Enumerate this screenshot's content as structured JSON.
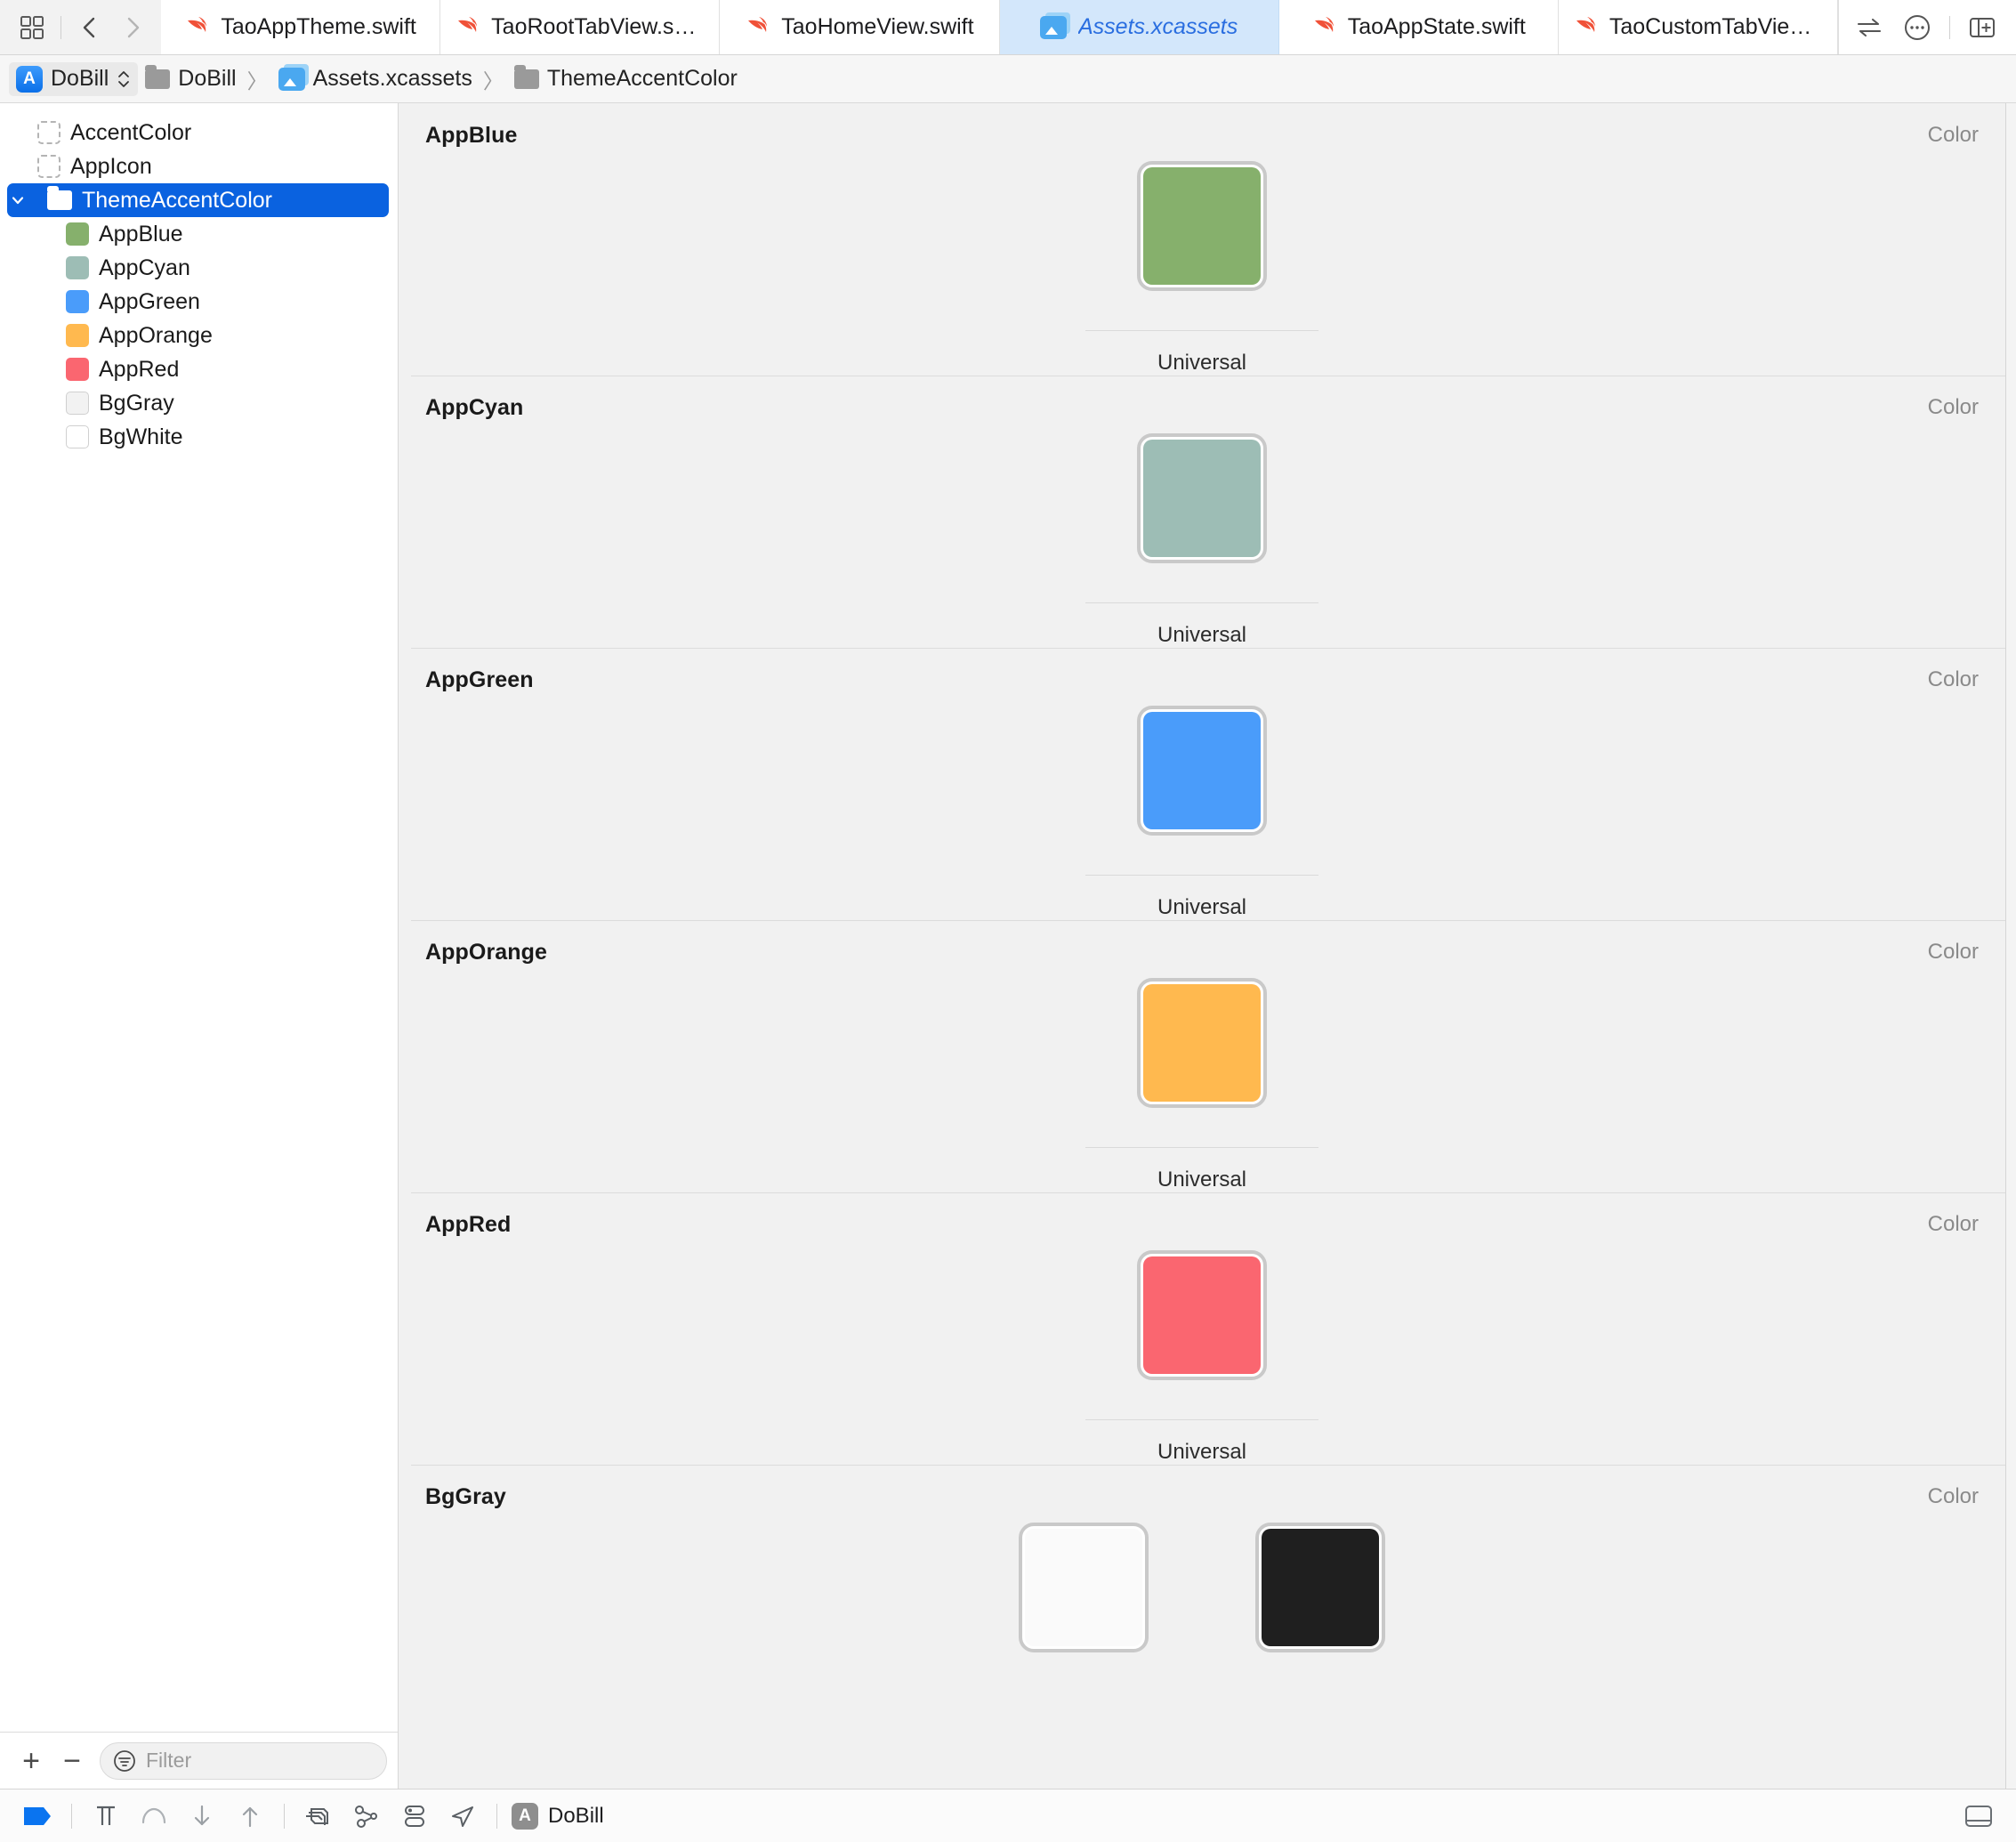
{
  "window": {
    "toolbar_right": [
      "swap-icon",
      "more-icon",
      "panel-right-icon"
    ]
  },
  "tabs": [
    {
      "label": "TaoAppTheme.swift",
      "icon": "swift-icon",
      "active": false
    },
    {
      "label": "TaoRootTabView.swift",
      "icon": "swift-icon",
      "active": false
    },
    {
      "label": "TaoHomeView.swift",
      "icon": "swift-icon",
      "active": false
    },
    {
      "label": "Assets.xcassets",
      "icon": "assets-icon",
      "active": true
    },
    {
      "label": "TaoAppState.swift",
      "icon": "swift-icon",
      "active": false
    },
    {
      "label": "TaoCustomTabView.swift",
      "icon": "swift-icon",
      "active": false
    }
  ],
  "breadcrumb": {
    "scheme": "DoBill",
    "items": [
      {
        "label": "DoBill",
        "icon": "folder-icon"
      },
      {
        "label": "Assets.xcassets",
        "icon": "assets-icon"
      },
      {
        "label": "ThemeAccentColor",
        "icon": "folder-icon"
      }
    ],
    "separator": "〉"
  },
  "sidebar": {
    "items": [
      {
        "label": "AccentColor",
        "icon": "placeholder-swatch-icon",
        "kind": "dashed",
        "color": "",
        "indent": 0,
        "selected": false
      },
      {
        "label": "AppIcon",
        "icon": "placeholder-swatch-icon",
        "kind": "dashed",
        "color": "",
        "indent": 0,
        "selected": false
      },
      {
        "label": "ThemeAccentColor",
        "icon": "folder-icon",
        "kind": "folder",
        "color": "",
        "indent": 0,
        "selected": true
      },
      {
        "label": "AppBlue",
        "icon": "color-swatch-icon",
        "kind": "color",
        "color": "#86b06c",
        "indent": 1,
        "selected": false
      },
      {
        "label": "AppCyan",
        "icon": "color-swatch-icon",
        "kind": "color",
        "color": "#9dbdb5",
        "indent": 1,
        "selected": false
      },
      {
        "label": "AppGreen",
        "icon": "color-swatch-icon",
        "kind": "color",
        "color": "#4a9cfa",
        "indent": 1,
        "selected": false
      },
      {
        "label": "AppOrange",
        "icon": "color-swatch-icon",
        "kind": "color",
        "color": "#ffb94f",
        "indent": 1,
        "selected": false
      },
      {
        "label": "AppRed",
        "icon": "color-swatch-icon",
        "kind": "color",
        "color": "#fa6670",
        "indent": 1,
        "selected": false
      },
      {
        "label": "BgGray",
        "icon": "color-swatch-icon",
        "kind": "outline",
        "color": "#f2f2f2",
        "indent": 1,
        "selected": false
      },
      {
        "label": "BgWhite",
        "icon": "color-swatch-icon",
        "kind": "outline",
        "color": "#ffffff",
        "indent": 1,
        "selected": false
      }
    ],
    "add_label": "+",
    "remove_label": "−",
    "filter_placeholder": "Filter"
  },
  "assets": {
    "kind_label": "Color",
    "sections": [
      {
        "name": "AppBlue",
        "variants": [
          {
            "label": "Universal",
            "color": "#86b06c"
          }
        ]
      },
      {
        "name": "AppCyan",
        "variants": [
          {
            "label": "Universal",
            "color": "#9dbdb5"
          }
        ]
      },
      {
        "name": "AppGreen",
        "variants": [
          {
            "label": "Universal",
            "color": "#4a9cfa"
          }
        ]
      },
      {
        "name": "AppOrange",
        "variants": [
          {
            "label": "Universal",
            "color": "#ffb94f"
          }
        ]
      },
      {
        "name": "AppRed",
        "variants": [
          {
            "label": "Universal",
            "color": "#fa6670"
          }
        ]
      },
      {
        "name": "BgGray",
        "variants": [
          {
            "label": "",
            "color": "#fafafa"
          },
          {
            "label": "",
            "color": "#1f1f1f"
          }
        ]
      }
    ]
  },
  "debugbar": {
    "process_label": "DoBill",
    "buttons": [
      "stop-icon",
      "pause-icon",
      "step-over-icon",
      "step-into-icon",
      "step-out-icon",
      "view-hierarchy-icon",
      "memory-graph-icon",
      "environment-overrides-icon",
      "simulate-location-icon"
    ],
    "right_button": "console-panel-icon"
  }
}
